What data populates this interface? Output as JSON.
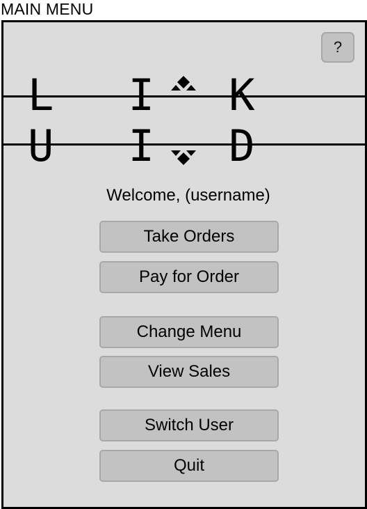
{
  "caption": "MAIN MENU",
  "help_button": {
    "label": "?"
  },
  "brand": {
    "name": "L I K U I D"
  },
  "welcome_text": "Welcome, (username)",
  "menu": {
    "take_orders": "Take Orders",
    "pay_for_order": "Pay for Order",
    "change_menu": "Change Menu",
    "view_sales": "View Sales",
    "switch_user": "Switch User",
    "quit": "Quit"
  },
  "colors": {
    "window_background": "#dcdcdc",
    "button_background": "#c2c2c2",
    "button_border": "#a8a8a8",
    "frame": "#000000"
  },
  "icons": {
    "ornament_top": "diamond-ornament-icon",
    "ornament_bottom": "diamond-ornament-icon"
  }
}
